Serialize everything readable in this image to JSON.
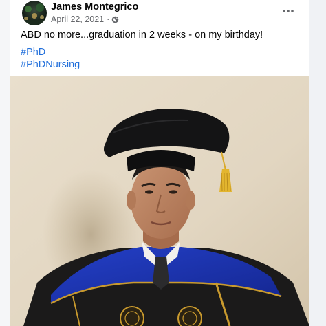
{
  "post": {
    "author_name": "James Montegrico",
    "date": "April 22, 2021",
    "separator": "·",
    "privacy_icon": "globe-icon",
    "more_icon": "more-options-icon",
    "text": "ABD no more...graduation in 2 weeks - on my birthday!",
    "hashtags": [
      "#PhD",
      "#PhDNursing"
    ]
  },
  "colors": {
    "hashtag": "#216fdb",
    "secondary_text": "#65676b",
    "gown_blue": "#1c2fa6",
    "gold_trim": "#c99a2e"
  }
}
